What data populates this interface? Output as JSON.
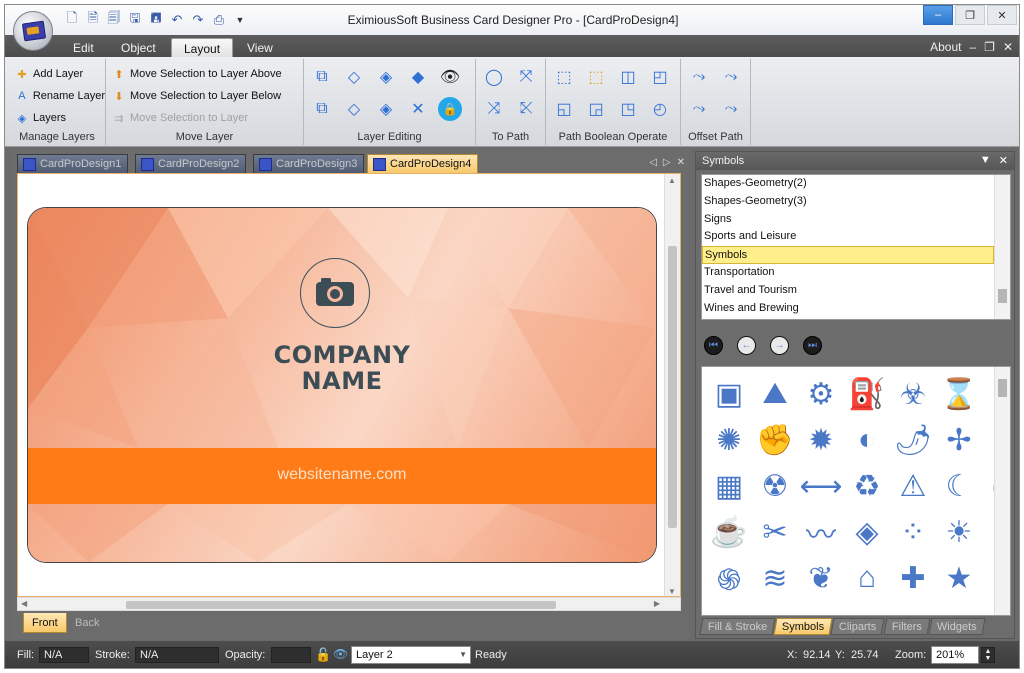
{
  "window": {
    "title": "EximiousSoft Business Card Designer Pro - [CardProDesign4]",
    "min_glyph": "–",
    "restore_glyph": "❐",
    "close_glyph": "✕"
  },
  "menu_tabs": [
    {
      "label": "Edit"
    },
    {
      "label": "Object"
    },
    {
      "label": "Layout"
    },
    {
      "label": "View"
    }
  ],
  "about": {
    "label": "About",
    "min_glyph": "–",
    "restore_glyph": "❐",
    "close_glyph": "✕"
  },
  "ribbon": {
    "manage_layers": {
      "label": "Manage Layers",
      "items": [
        {
          "label": "Add Layer"
        },
        {
          "label": "Rename Layer"
        },
        {
          "label": "Layers"
        }
      ]
    },
    "move_layer": {
      "label": "Move Layer",
      "items": [
        {
          "label": "Move Selection to Layer Above"
        },
        {
          "label": "Move Selection to Layer Below"
        },
        {
          "label": "Move Selection to Layer"
        }
      ]
    },
    "layer_editing": {
      "label": "Layer Editing"
    },
    "to_path": {
      "label": "To Path"
    },
    "path_boolean": {
      "label": "Path Boolean Operate"
    },
    "offset_path": {
      "label": "Offset Path"
    }
  },
  "doc_tabs": [
    {
      "label": "CardProDesign1"
    },
    {
      "label": "CardProDesign2"
    },
    {
      "label": "CardProDesign3"
    },
    {
      "label": "CardProDesign4"
    }
  ],
  "card": {
    "company_line1": "COMPANY",
    "company_line2": "NAME",
    "website": "websitename.com",
    "band_color": "#fe7b18",
    "text_color": "#3d4d56"
  },
  "side_tabs": [
    {
      "label": "Front"
    },
    {
      "label": "Back"
    }
  ],
  "symbols_panel": {
    "title": "Symbols",
    "categories": [
      "Shapes-Geometry(2)",
      "Shapes-Geometry(3)",
      "Signs",
      "Sports and Leisure",
      "Symbols",
      "Transportation",
      "Travel and Tourism",
      "Wines and Brewing"
    ],
    "selected": "Symbols",
    "bottom_tabs": [
      {
        "label": "Fill & Stroke"
      },
      {
        "label": "Symbols"
      },
      {
        "label": "Cliparts"
      },
      {
        "label": "Filters"
      },
      {
        "label": "Widgets"
      }
    ]
  },
  "status": {
    "fill_label": "Fill:",
    "fill_value": "N/A",
    "stroke_label": "Stroke:",
    "stroke_value": "N/A",
    "opacity_label": "Opacity:",
    "layer_value": "Layer 2",
    "state": "Ready",
    "x_label": "X:",
    "x_value": "92.14",
    "y_label": "Y:",
    "y_value": "25.74",
    "zoom_label": "Zoom:",
    "zoom_value": "201%"
  }
}
